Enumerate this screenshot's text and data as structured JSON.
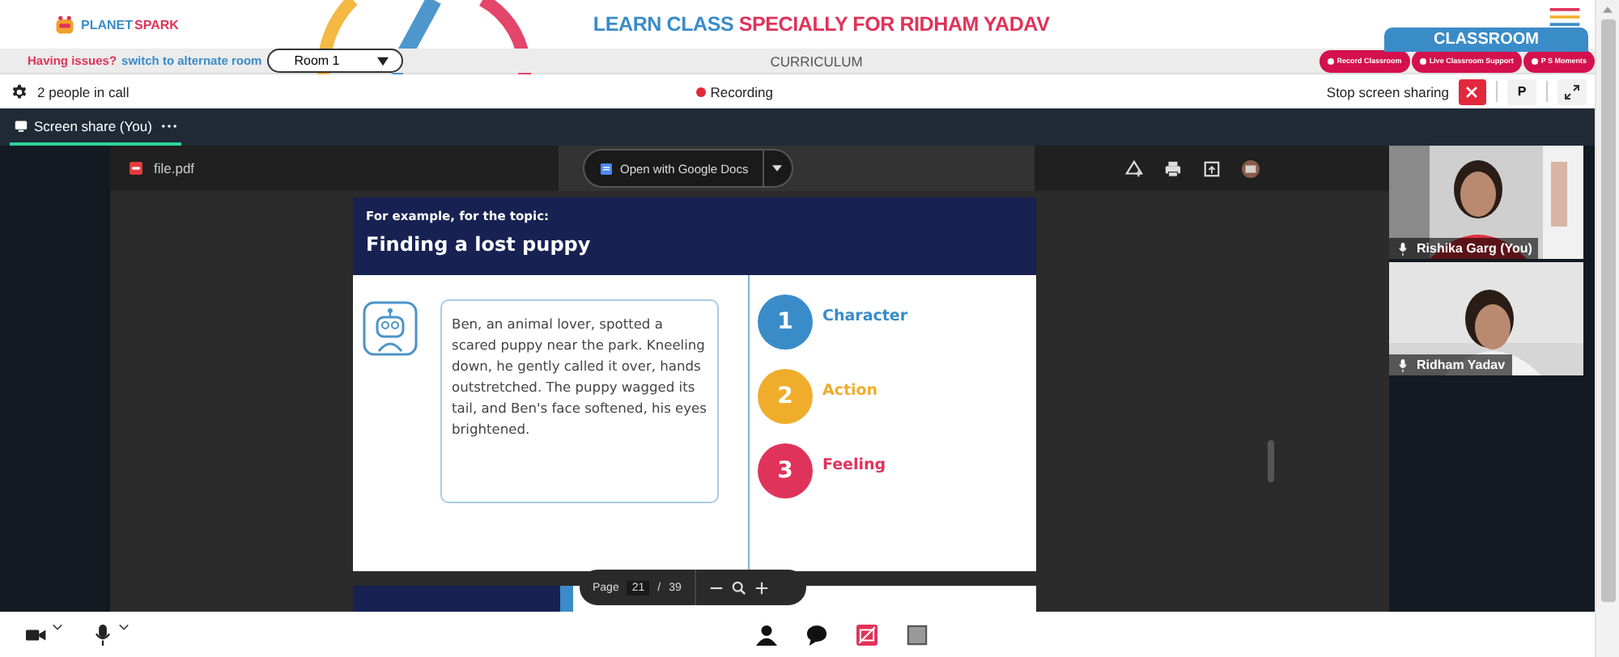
{
  "header": {
    "logo": {
      "first": "PLANET",
      "second": "SPARK"
    },
    "title": {
      "lead": "LEARN CLASS",
      "highlight": "SPECIALLY FOR RIDHAM YADAV"
    }
  },
  "sub_bar": {
    "issue": "Having issues?",
    "link": "switch to alternate room",
    "room_select": {
      "value": "Room 1"
    },
    "section_label": "CURRICULUM",
    "classroom_tab": "CLASSROOM",
    "action_buttons": [
      "Record Classroom",
      "Live Classroom Support",
      "P S Moments"
    ]
  },
  "call_bar": {
    "people": "2 people in call",
    "recording": "Recording",
    "stop_label": "Stop screen sharing",
    "presenter_button": "P"
  },
  "tabs": [
    {
      "label": "Screen share (You)",
      "selected": true
    }
  ],
  "pdf": {
    "file_name": "file.pdf",
    "open_with": "Open with Google Docs",
    "page": {
      "intro": "For example, for the topic:",
      "title": "Finding a lost puppy",
      "story": "Ben, an animal lover, spotted a scared puppy near the park. Kneeling down, he gently called it over, hands outstretched. The puppy wagged its tail, and Ben's face softened, his eyes brightened.",
      "steps": [
        {
          "number": "1",
          "label": "Character",
          "color": "#3a8cc8"
        },
        {
          "number": "2",
          "label": "Action",
          "color": "#f0ad2c"
        },
        {
          "number": "3",
          "label": "Feeling",
          "color": "#e0335a"
        }
      ]
    },
    "page_controls": {
      "label": "Page",
      "current": "21",
      "separator": "/",
      "total": "39"
    }
  },
  "participants": [
    {
      "name": "Rishika Garg (You)",
      "kind": "picture"
    },
    {
      "name": "Ridham Yadav",
      "kind": "picture"
    }
  ]
}
